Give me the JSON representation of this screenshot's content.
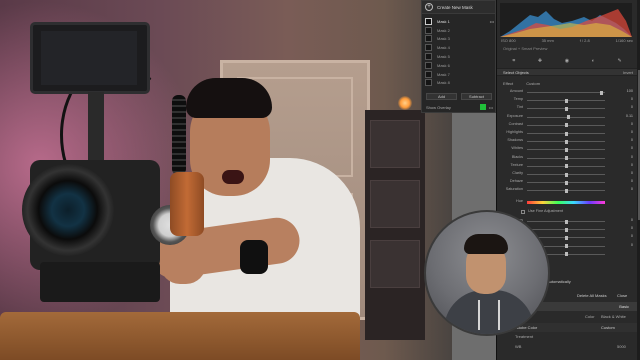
{
  "mask_panel": {
    "title": "Create New Mask",
    "masks": [
      {
        "label": "Mask 1",
        "active": true
      },
      {
        "label": "Mask 2",
        "active": false
      },
      {
        "label": "Mask 3",
        "active": false
      },
      {
        "label": "Mask 4",
        "active": false
      },
      {
        "label": "Mask 5",
        "active": false
      },
      {
        "label": "Mask 6",
        "active": false
      },
      {
        "label": "Mask 7",
        "active": false
      },
      {
        "label": "Mask 8",
        "active": false
      }
    ],
    "add_label": "Add",
    "subtract_label": "Subtract",
    "show_overlay_label": "Show Overlay",
    "overlay_color": "#20c03a"
  },
  "develop_panel": {
    "histogram_info": [
      "ISO 800",
      "35 mm",
      "f / 2.8",
      "1/160 sec"
    ],
    "photo_tag": "Original + Smart Preview",
    "tools": [
      "crop-icon",
      "heal-icon",
      "redeye-icon",
      "mask-icon",
      "brush-icon"
    ],
    "select_objects_label": "Select Objects",
    "invert_label": "Invert",
    "effect_label": "Effect",
    "custom_label": "Custom",
    "sliders": [
      {
        "label": "Amount",
        "value": "100",
        "pos": 0.95
      },
      {
        "label": "Temp",
        "value": "0",
        "pos": 0.5
      },
      {
        "label": "Tint",
        "value": "0",
        "pos": 0.5
      },
      {
        "label": "Exposure",
        "value": "0.11",
        "pos": 0.53
      },
      {
        "label": "Contrast",
        "value": "0",
        "pos": 0.5
      },
      {
        "label": "Highlights",
        "value": "0",
        "pos": 0.5
      },
      {
        "label": "Shadows",
        "value": "0",
        "pos": 0.5
      },
      {
        "label": "Whites",
        "value": "0",
        "pos": 0.5
      },
      {
        "label": "Blacks",
        "value": "0",
        "pos": 0.5
      },
      {
        "label": "Texture",
        "value": "0",
        "pos": 0.5
      },
      {
        "label": "Clarity",
        "value": "0",
        "pos": 0.5
      },
      {
        "label": "Dehaze",
        "value": "0",
        "pos": 0.5
      },
      {
        "label": "Saturation",
        "value": "0",
        "pos": 0.5
      }
    ],
    "hue_label": "Hue",
    "fine_label": "Use Fine Adjustment",
    "sub_sliders": [
      {
        "label": "Sharpness",
        "value": "0",
        "pos": 0.5
      },
      {
        "label": "Noise",
        "value": "0",
        "pos": 0.5
      },
      {
        "label": "Moire",
        "value": "0",
        "pos": 0.5
      },
      {
        "label": "Defringe",
        "value": "0",
        "pos": 0.5
      },
      {
        "label": "Color",
        "value": "",
        "pos": 0.5
      }
    ],
    "auto_label": "Automatically",
    "delete_all_label": "Delete All Masks",
    "close_label": "Close",
    "basic_label": "Basic",
    "color_label": "Color",
    "bw_label": "Black & White",
    "profile_label": "Adobe Color",
    "custom_wb_label": "Custom",
    "treatment_label": "Treatment",
    "wb_label": "WB",
    "temp_value": "5000"
  }
}
